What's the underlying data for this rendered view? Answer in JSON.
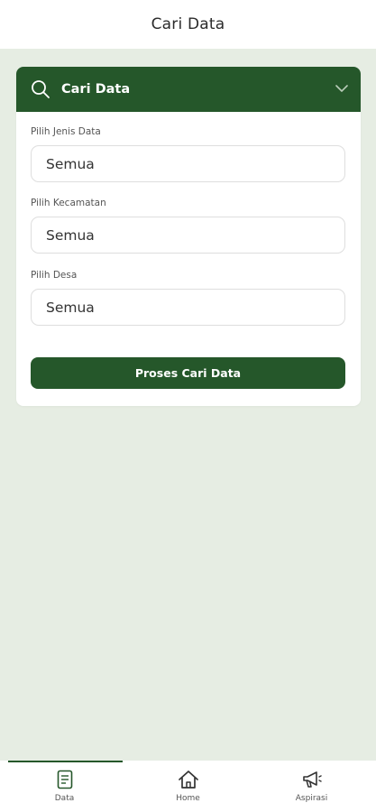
{
  "app_bar": {
    "title": "Cari Data"
  },
  "search_card": {
    "title": "Cari Data",
    "fields": [
      {
        "label": "Pilih Jenis Data",
        "value": "Semua"
      },
      {
        "label": "Pilih Kecamatan",
        "value": "Semua"
      },
      {
        "label": "Pilih Desa",
        "value": "Semua"
      }
    ],
    "submit_label": "Proses Cari Data"
  },
  "bottom_nav": {
    "items": [
      {
        "label": "Data",
        "icon": "document-icon"
      },
      {
        "label": "Home",
        "icon": "home-icon"
      },
      {
        "label": "Aspirasi",
        "icon": "megaphone-icon"
      }
    ]
  },
  "colors": {
    "primary": "#25572a",
    "background": "#e6ede3"
  }
}
